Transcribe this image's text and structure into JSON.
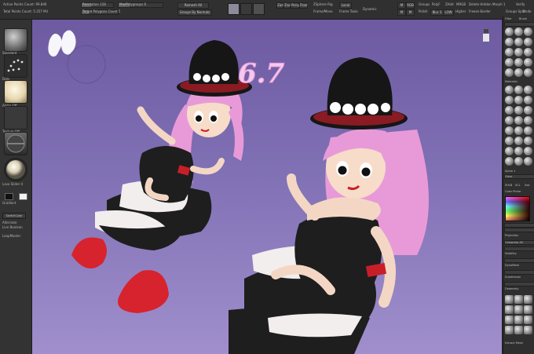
{
  "topbar": {
    "active_points": "Active Points Count: 99.846",
    "total_points": "Total Points Count: 5.257 Mil",
    "resolution": "Resolution 128",
    "target_polys": "Target Polygons Count 5",
    "max_polygroups": "MaxPolygroups 6",
    "remesh_btn": "Remesh All",
    "groups_normals": "Groups By Normals",
    "move_btn": "Move",
    "zadd": "Zadd",
    "zsub": "Zsub",
    "persp": "Persp",
    "floor": "Floor",
    "local": "Local",
    "zsphere": "ZSphere Rig",
    "frame": "Frame/Move",
    "frame_tools": "Frame Tools",
    "dynamic": "Dynamic",
    "group_btn": "Groups",
    "polyf": "PolyF",
    "zadd2": "ZAdd",
    "mrgb": "MRGB",
    "polish": "Polish",
    "blur": "Blur 3",
    "lowres": "LOW",
    "higher": "Higher",
    "del_hidden": "Delete Hidden",
    "freeze": "Freeze Border",
    "morph": "Morph 1",
    "vercy": "Verify",
    "grp_split": "Groups Split",
    "undo": "Undo"
  },
  "leftshelf": {
    "standard_label": "Standard",
    "dots_label": "Dots",
    "mat_label": "",
    "alpha_label": "Alpha Off",
    "texture_label": "Texture Off",
    "material_label": "Lava Slider 4",
    "gradient_label": "Gradient",
    "switch_color": "SwitchColor",
    "alternate": "Alternate",
    "live_boolean": "Live Boolean",
    "loop_mode": "LoopMaster"
  },
  "viewport": {
    "version_label": "6.7"
  },
  "rightshelf": {
    "top_labels": [
      "Filter",
      "Bck",
      "Brush",
      "Lsd"
    ],
    "section1": "Materials",
    "section2": "Alpha 1",
    "clear_btn": "Clear",
    "resize_labels": [
      "SHLB",
      "SCL",
      "Swt"
    ],
    "color_label": "Color Picker",
    "section3": "Projection",
    "compress": "Compress All",
    "vis": "Visibility",
    "dynamesh": "DynaMesh",
    "subdiv": "Subdivision",
    "geometry": "Geometry",
    "extract_label": "Extract Mesh"
  },
  "colors": {
    "bg_top": "#6d5aa1",
    "bg_bottom": "#a08fcc",
    "hair": "#e89ad8",
    "dress": "#1e1e1e",
    "boot": "#d7232e"
  }
}
